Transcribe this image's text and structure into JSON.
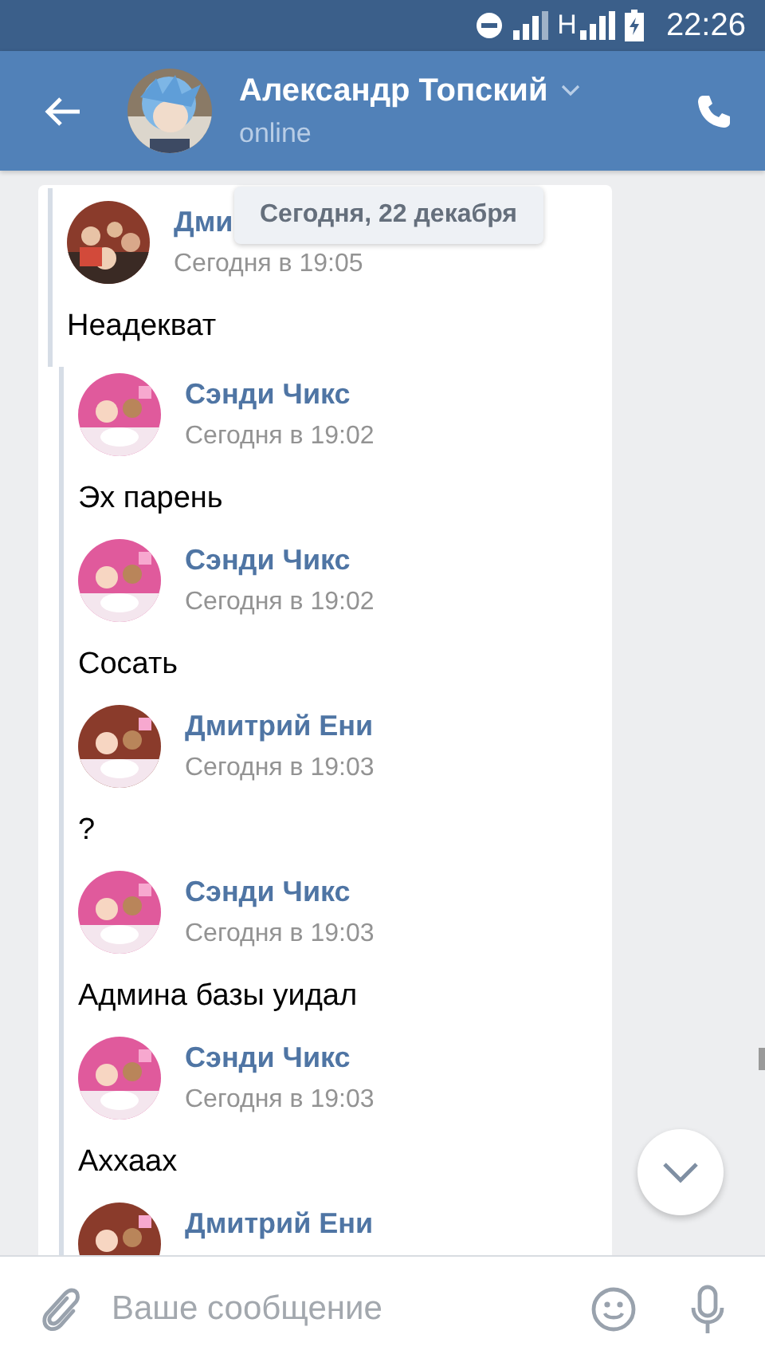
{
  "status_bar": {
    "network": "H",
    "time": "22:26"
  },
  "header": {
    "name": "Александр Топский",
    "status": "online"
  },
  "date_badge": "Сегодня, 22 декабря",
  "forwarded": {
    "sender": "Дми",
    "time": "Сегодня в 19:05",
    "text": "Неадекват",
    "color": "#8a3b2b"
  },
  "nested_messages": [
    {
      "sender": "Сэнди Чикс",
      "time": "Сегодня в 19:02",
      "text": "Эх парень",
      "color": "#e05a9c"
    },
    {
      "sender": "Сэнди Чикс",
      "time": "Сегодня в 19:02",
      "text": "Сосать",
      "color": "#e05a9c"
    },
    {
      "sender": "Дмитрий Ени",
      "time": "Сегодня в 19:03",
      "text": "?",
      "color": "#8a3b2b"
    },
    {
      "sender": "Сэнди Чикс",
      "time": "Сегодня в 19:03",
      "text": "Админа базы уидал",
      "color": "#e05a9c"
    },
    {
      "sender": "Сэнди Чикс",
      "time": "Сегодня в 19:03",
      "text": "Аххаах",
      "color": "#e05a9c"
    },
    {
      "sender": "Дмитрий Ени",
      "color": "#8a3b2b"
    }
  ],
  "composer": {
    "placeholder": "Ваше сообщение"
  }
}
